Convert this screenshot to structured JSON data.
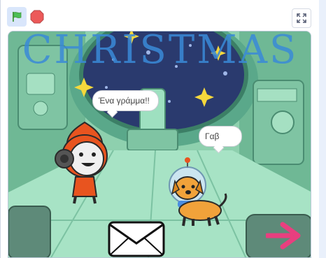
{
  "toolbar": {
    "green_flag_icon": "green-flag-icon",
    "stop_icon": "stop-sign-icon",
    "fullscreen_icon": "fullscreen-icon"
  },
  "stage": {
    "title_text": "CHRISTMAS",
    "speech_bubbles": [
      {
        "speaker": "robot",
        "text": "Ένα γράμμα!!"
      },
      {
        "speaker": "dog",
        "text": "Γαβ"
      }
    ],
    "sprites": [
      "robot-sprite",
      "dog-sprite",
      "envelope-sprite",
      "arrow-sprite"
    ]
  },
  "colors": {
    "flag_green": "#4cbf56",
    "stop_red": "#ec5959",
    "title_blue": "#3a8ad8",
    "arrow_pink": "#e83f7f",
    "accent_bg": "#d9e6fb"
  }
}
